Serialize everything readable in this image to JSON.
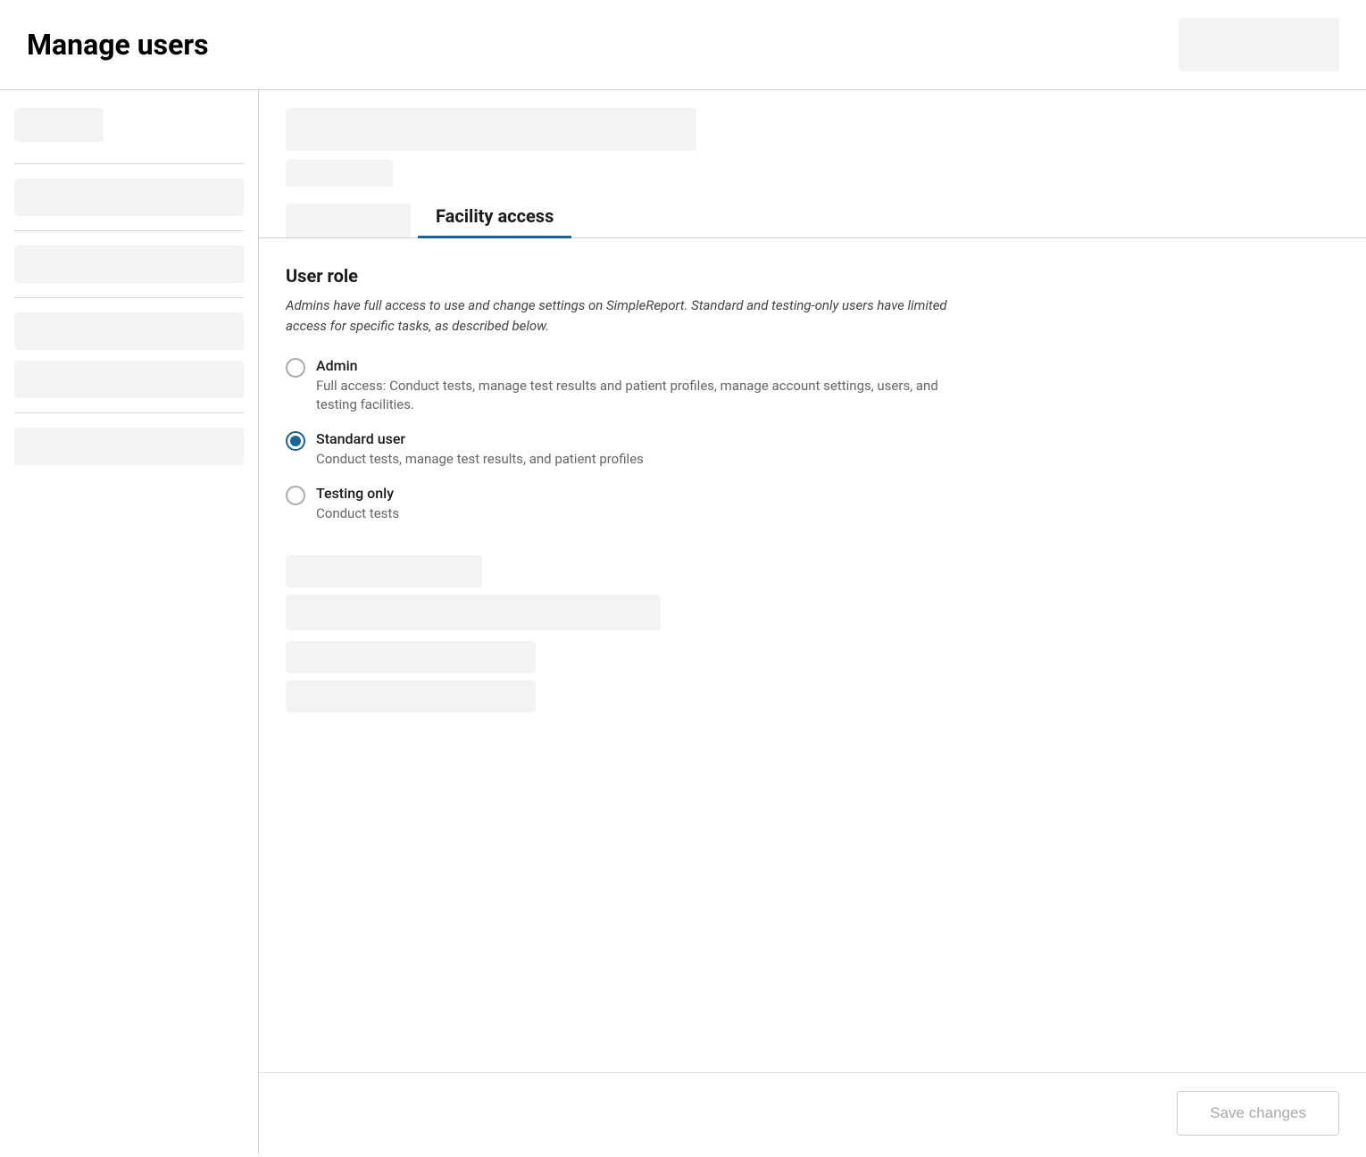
{
  "header": {
    "title": "Manage users"
  },
  "tabs": {
    "active_label": "Facility access"
  },
  "user_role_section": {
    "title": "User role",
    "description": "Admins have full access to use and change settings on SimpleReport. Standard and testing-only users have limited access for specific tasks, as described below.",
    "options": [
      {
        "label": "Admin",
        "description": "Full access: Conduct tests, manage test results and patient profiles, manage account settings, users, and testing facilities.",
        "checked": false
      },
      {
        "label": "Standard user",
        "description": "Conduct tests, manage test results, and patient profiles",
        "checked": true
      },
      {
        "label": "Testing only",
        "description": "Conduct tests",
        "checked": false
      }
    ]
  },
  "footer": {
    "save_label": "Save changes"
  }
}
